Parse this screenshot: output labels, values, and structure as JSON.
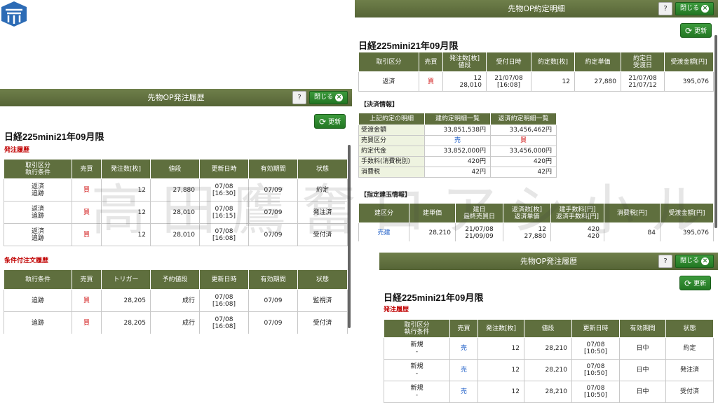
{
  "colors": {
    "header": "#5f6f3e",
    "titlebar": "#6f7f4a",
    "button_green": "#2a872a",
    "buy_red": "#d21a1a",
    "sell_blue": "#1f5fc8"
  },
  "watermark": "高田鷹奮ロアシ小ル",
  "common": {
    "help": "?",
    "close": "閉じる",
    "refresh": "更新"
  },
  "panel1": {
    "title": "先物OP発注履歴",
    "heading": "日経225mini21年09月限",
    "order_label": "発注履歴",
    "order_headers": [
      "取引区分\n執行条件",
      "売買",
      "発注数[枚]",
      "値段",
      "更新日時",
      "有効期間",
      "状態"
    ],
    "order_rows": [
      [
        "返済\n追跡",
        "買",
        "12",
        "27,880",
        "07/08\n[16:30]",
        "07/09",
        "約定"
      ],
      [
        "返済\n追跡",
        "買",
        "12",
        "28,010",
        "07/08\n[16:15]",
        "07/09",
        "発注済"
      ],
      [
        "返済\n追跡",
        "買",
        "12",
        "28,010",
        "07/08\n[16:08]",
        "07/09",
        "受付済"
      ]
    ],
    "cond_label": "条件付注文履歴",
    "cond_headers": [
      "執行条件",
      "売買",
      "トリガー",
      "予約値段",
      "更新日時",
      "有効期間",
      "状態"
    ],
    "cond_rows": [
      [
        "追跡",
        "買",
        "28,205",
        "成行",
        "07/08\n[16:08]",
        "07/09",
        "監視済"
      ],
      [
        "追跡",
        "買",
        "28,205",
        "成行",
        "07/08\n[16:08]",
        "07/09",
        "受付済"
      ]
    ]
  },
  "panel2": {
    "title": "先物OP約定明細",
    "heading": "日経225mini21年09月限",
    "headers": [
      "取引区分",
      "売買",
      "発注数[枚]\n値段",
      "受付日時",
      "約定数[枚]",
      "約定単価",
      "約定日\n受渡日",
      "受渡金額[円]"
    ],
    "row": [
      "返済",
      "買",
      "12\n28,010",
      "21/07/08\n[16:08]",
      "12",
      "27,880",
      "21/07/08\n21/07/12",
      "395,076"
    ],
    "settle_label": "【決済情報】",
    "settle_headers": [
      "上記約定の明細",
      "建約定明細一覧",
      "返済約定明細一覧"
    ],
    "settle_rows": [
      [
        "受渡金額",
        "33,851,538円",
        "33,456,462円"
      ],
      [
        "売買区分",
        "売",
        "買"
      ],
      [
        "約定代金",
        "33,852,000円",
        "33,456,000円"
      ],
      [
        "手数料(消費税別)",
        "420円",
        "420円"
      ],
      [
        "消費税",
        "42円",
        "42円"
      ]
    ],
    "pos_label": "【指定建玉情報】",
    "pos_headers": [
      "建区分",
      "建単価",
      "建日\n最終売買日",
      "返済数[枚]\n返済単価",
      "建手数料[円]\n返済手数料[円]",
      "消費税[円]",
      "受渡金額[円]"
    ],
    "pos_row": [
      "売建",
      "28,210",
      "21/07/08\n21/09/09",
      "12\n27,880",
      "420\n420",
      "84",
      "395,076"
    ]
  },
  "panel3": {
    "title": "先物OP発注履歴",
    "heading": "日経225mini21年09月限",
    "order_label": "発注履歴",
    "order_headers": [
      "取引区分\n執行条件",
      "売買",
      "発注数[枚]",
      "値段",
      "更新日時",
      "有効期間",
      "状態"
    ],
    "order_rows": [
      [
        "新規\n-",
        "売",
        "12",
        "28,210",
        "07/08\n[10:50]",
        "日中",
        "約定"
      ],
      [
        "新規\n-",
        "売",
        "12",
        "28,210",
        "07/08\n[10:50]",
        "日中",
        "発注済"
      ],
      [
        "新規\n-",
        "売",
        "12",
        "28,210",
        "07/08\n[10:50]",
        "日中",
        "受付済"
      ]
    ]
  }
}
